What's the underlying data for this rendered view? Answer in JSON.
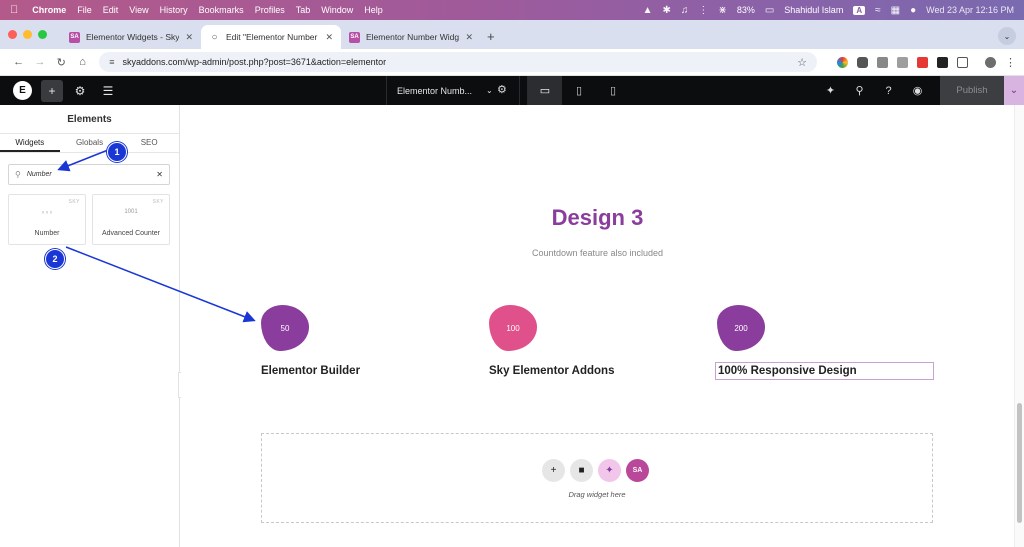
{
  "macos": {
    "menu": [
      "File",
      "Edit",
      "View",
      "History",
      "Bookmarks",
      "Profiles",
      "Tab",
      "Window",
      "Help"
    ],
    "app": "Chrome",
    "battery": "83%",
    "user": "Shahidul Islam",
    "input_source": "A",
    "datetime": "Wed 23 Apr  12:16 PM"
  },
  "tabs": [
    {
      "title": "Elementor Widgets - Sky Addons",
      "favicon": "SA"
    },
    {
      "title": "Edit \"Elementor Number Widget\"",
      "favicon": "globe"
    },
    {
      "title": "Elementor Number Widget - Sky",
      "favicon": "SA"
    }
  ],
  "address": {
    "url": "skyaddons.com/wp-admin/post.php?post=3671&action=elementor"
  },
  "editor": {
    "doc_title": "Elementor Numb...",
    "publish": "Publish",
    "logo": "E"
  },
  "panel": {
    "title": "Elements",
    "tabs": [
      "Widgets",
      "Globals",
      "SEO"
    ],
    "search_value": "Number",
    "widgets": [
      {
        "label": "Number",
        "brand": "SKY",
        "icon_glyph": "₀ ₀ ₀"
      },
      {
        "label": "Advanced Counter",
        "brand": "SKY",
        "icon_glyph": "1001"
      }
    ]
  },
  "canvas": {
    "heading": "Design 3",
    "subheading": "Countdown feature also included",
    "counters": [
      {
        "value": "50",
        "title": "Elementor Builder",
        "color": "#8a3d9c"
      },
      {
        "value": "100",
        "title": "Sky Elementor Addons",
        "color": "#e0508a"
      },
      {
        "value": "200",
        "title": "100% Responsive Design",
        "color": "#8a3d9c"
      }
    ],
    "dropzone_text": "Drag widget here"
  },
  "annotations": [
    "1",
    "2"
  ],
  "colors": {
    "accent": "#8a3d9c",
    "pink": "#e0508a",
    "annotation": "#1a37d6"
  }
}
